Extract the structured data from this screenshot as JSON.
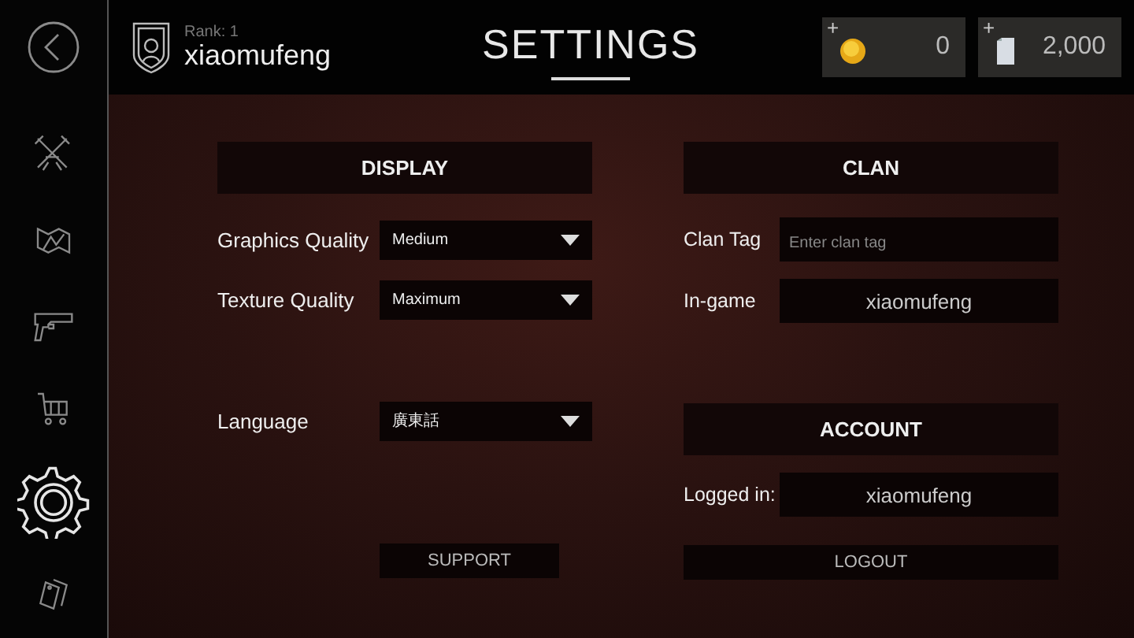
{
  "header": {
    "rank": "Rank: 1",
    "username": "xiaomufeng",
    "title": "SETTINGS"
  },
  "currencies": [
    {
      "kind": "coin",
      "plus": "+",
      "amount": "0"
    },
    {
      "kind": "card",
      "plus": "+",
      "amount": "2,000"
    }
  ],
  "sidebar": {
    "items": [
      {
        "kind": "weapons",
        "selected": false
      },
      {
        "kind": "map",
        "selected": false
      },
      {
        "kind": "pistol",
        "selected": false
      },
      {
        "kind": "cart",
        "selected": false
      },
      {
        "kind": "gear",
        "selected": true
      },
      {
        "kind": "tags",
        "selected": false
      }
    ]
  },
  "display": {
    "heading": "DISPLAY",
    "rows": [
      {
        "label": "Graphics Quality",
        "value": "Medium"
      },
      {
        "label": "Texture Quality",
        "value": "Maximum"
      },
      {
        "label": "Language",
        "value": "廣東話"
      }
    ],
    "support": "SUPPORT"
  },
  "clan": {
    "heading": "CLAN",
    "fields": [
      {
        "label": "Clan Tag",
        "placeholder": "Enter clan tag"
      },
      {
        "label": "In-game",
        "value": "xiaomufeng"
      }
    ]
  },
  "account": {
    "heading": "ACCOUNT",
    "label": "Logged in:",
    "value": "xiaomufeng",
    "logout": "LOGOUT"
  }
}
